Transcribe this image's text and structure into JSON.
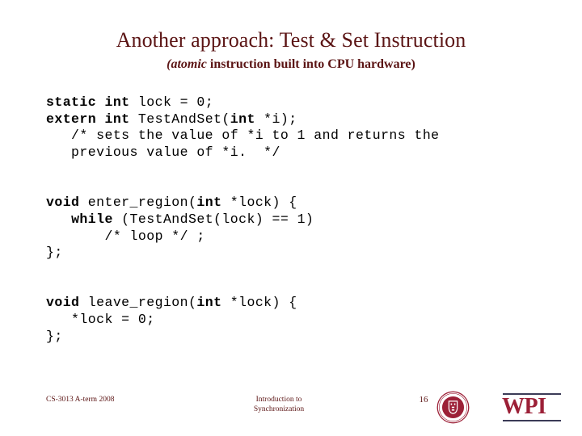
{
  "slide": {
    "title": "Another approach: Test & Set Instruction",
    "subtitle_italic": "(atomic",
    "subtitle_rest": " instruction built into CPU hardware)",
    "accent_color": "#5b1414",
    "code_color": "#000000",
    "logo_color": "#9c2037",
    "background_color": "#ffffff"
  },
  "code": {
    "block1": [
      {
        "bold": "static int",
        "plain": " lock = 0;"
      },
      {
        "bold": "extern int",
        "plain": " TestAndSet(",
        "bold2": "int",
        "plain2": " *i);"
      },
      {
        "plain": "   /* sets the value of *i to 1 and returns the"
      },
      {
        "plain": "   previous value of *i.  */"
      }
    ],
    "block2": [
      {
        "bold": "void",
        "plain": " enter_region(",
        "bold2": "int",
        "plain2": " *lock) {"
      },
      {
        "plain": "   ",
        "bold": "while",
        "plain2": " (TestAndSet(lock) == 1)"
      },
      {
        "plain": "       /* loop */ ;"
      },
      {
        "plain": "};"
      }
    ],
    "block3": [
      {
        "bold": "void",
        "plain": " leave_region(",
        "bold2": "int",
        "plain2": " *lock) {"
      },
      {
        "plain": "   *lock = 0;"
      },
      {
        "plain": "};"
      }
    ]
  },
  "footer": {
    "course": "CS-3013 A-term 2008",
    "topic_line1": "Introduction to",
    "topic_line2": "Synchronization",
    "page_number": "16",
    "logo_text": "WPI"
  }
}
